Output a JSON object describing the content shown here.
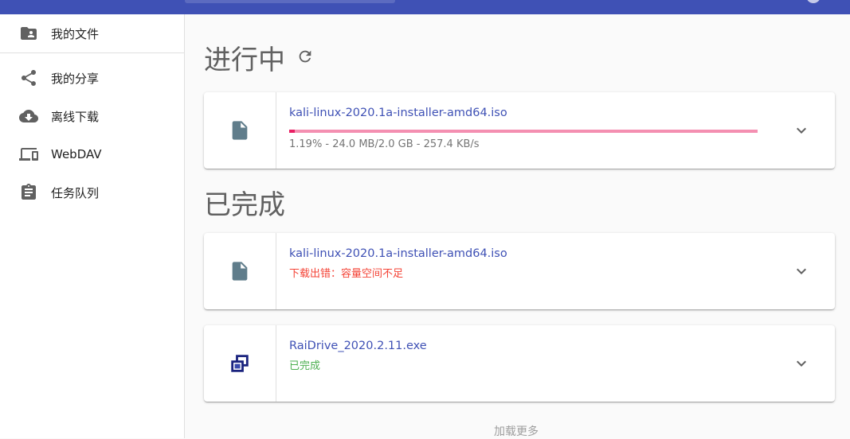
{
  "colors": {
    "primary": "#3f51b5",
    "progress_bar": "#e91e63",
    "progress_track": "#f48fb1",
    "error": "#f44336",
    "success": "#4caf50"
  },
  "sidebar": {
    "items": [
      {
        "label": "我的文件",
        "icon": "folder-account-icon"
      },
      {
        "label": "我的分享",
        "icon": "share-icon"
      },
      {
        "label": "离线下载",
        "icon": "cloud-download-icon"
      },
      {
        "label": "WebDAV",
        "icon": "devices-icon"
      },
      {
        "label": "任务队列",
        "icon": "clipboard-icon"
      }
    ]
  },
  "in_progress": {
    "title": "进行中",
    "items": [
      {
        "filename": "kali-linux-2020.1a-installer-amd64.iso",
        "progress_fraction": 0.0119,
        "progress_text": "1.19% - 24.0 MB/2.0 GB - 257.4 KB/s"
      }
    ]
  },
  "completed": {
    "title": "已完成",
    "items": [
      {
        "filename": "kali-linux-2020.1a-installer-amd64.iso",
        "status": "下载出错：容量空间不足",
        "status_type": "error"
      },
      {
        "filename": "RaiDrive_2020.2.11.exe",
        "status": "已完成",
        "status_type": "success"
      }
    ]
  },
  "load_more": "加载更多"
}
